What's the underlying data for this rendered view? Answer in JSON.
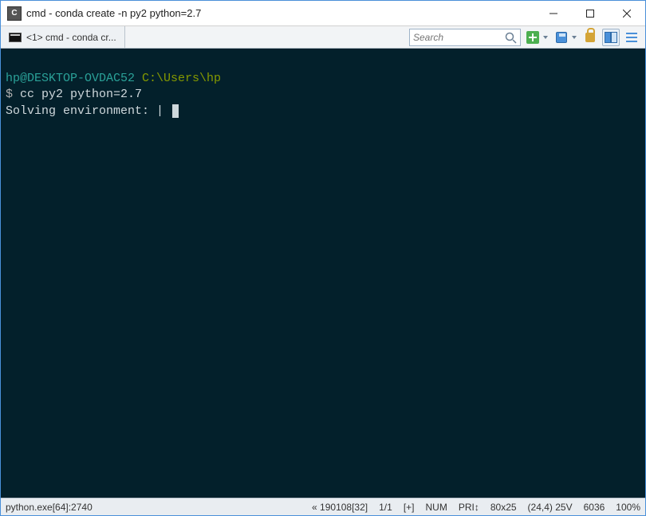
{
  "window": {
    "title": "cmd - conda  create -n py2 python=2.7",
    "app_icon_letter": "C"
  },
  "tab": {
    "label": "<1> cmd - conda  cr..."
  },
  "toolbar": {
    "search_placeholder": "Search"
  },
  "terminal": {
    "user_host": "hp@DESKTOP-OVDAC52",
    "cwd": "C:\\Users\\hp",
    "prompt_symbol": "$",
    "command": "cc py2 python=2.7",
    "output_line": "Solving environment: |"
  },
  "status": {
    "process": "python.exe[64]:2740",
    "time": "« 190108[32]",
    "split": "1/1",
    "flags": "[+]",
    "num": "NUM",
    "pri": "PRI↕",
    "size": "80x25",
    "cursor": "(24,4) 25V",
    "pid": "6036",
    "zoom": "100%"
  }
}
